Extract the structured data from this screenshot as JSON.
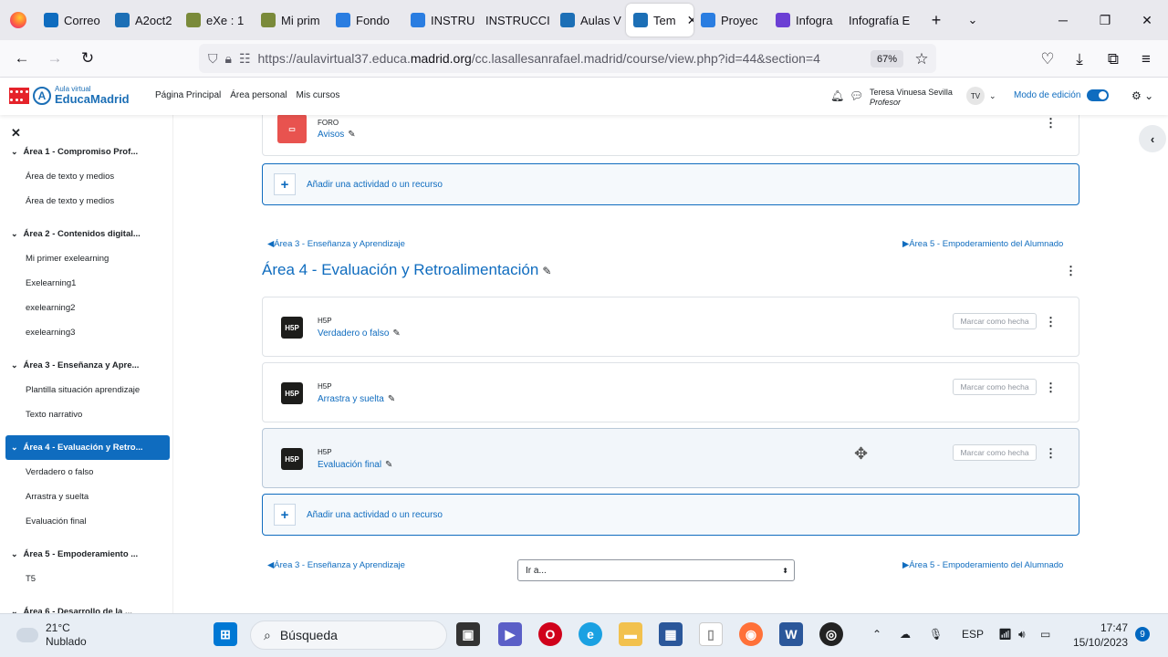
{
  "browser": {
    "tabs": [
      {
        "label": "Correo",
        "icon": "mail-icon",
        "color": "#0f6cbf"
      },
      {
        "label": "A2oct2",
        "icon": "moodle-cap-icon",
        "color": "#1c6fb6"
      },
      {
        "label": "eXe : 1",
        "icon": "exe-icon",
        "color": "#7a8a3a"
      },
      {
        "label": "Mi prim",
        "icon": "exe-icon",
        "color": "#7a8a3a"
      },
      {
        "label": "Fondo",
        "icon": "edge-c-icon",
        "color": "#2a7de1"
      },
      {
        "label": "INSTRU",
        "icon": "edge-c-icon",
        "color": "#2a7de1"
      },
      {
        "label": "INSTRUCCI",
        "icon": "",
        "color": "#888888"
      },
      {
        "label": "Aulas V",
        "icon": "aula-icon",
        "color": "#1c6fb6"
      },
      {
        "label": "Tem",
        "icon": "moodle-cap-icon",
        "color": "#1c6fb6",
        "active": true
      },
      {
        "label": "Proyec",
        "icon": "edge-c-icon",
        "color": "#2a7de1"
      },
      {
        "label": "Infogra",
        "icon": "doc-icon",
        "color": "#6b3fd4"
      },
      {
        "label": "Infografía E",
        "icon": "",
        "color": "#888888"
      }
    ],
    "url_prefix": "https://aulavirtual37.educa.",
    "url_host": "madrid.org",
    "url_suffix": "/cc.lasallesanrafael.madrid/course/view.php?id=44&section=4",
    "zoom": "67%"
  },
  "moodle": {
    "logo_top": "Aula virtual",
    "logo_bottom": "EducaMadrid",
    "nav": [
      "Página Principal",
      "Área personal",
      "Mis cursos"
    ],
    "user_name": "Teresa Vinuesa Sevilla",
    "user_role": "Profesor",
    "user_initials": "TV",
    "edit_mode_label": "Modo de edición"
  },
  "sidebar": {
    "sections": [
      {
        "title": "Área 1 - Compromiso Prof...",
        "items": [
          "Área de texto y medios",
          "Área de texto y medios"
        ]
      },
      {
        "title": "Área 2 - Contenidos digital...",
        "items": [
          "Mi primer exelearning",
          "Exelearning1",
          "exelearning2",
          "exelearning3"
        ]
      },
      {
        "title": "Área 3 - Enseñanza y Apre...",
        "items": [
          "Plantilla situación aprendizaje",
          "Texto narrativo"
        ]
      },
      {
        "title": "Área 4 - Evaluación y Retro...",
        "items": [
          "Verdadero o falso",
          "Arrastra y suelta",
          "Evaluación final"
        ],
        "active": true
      },
      {
        "title": "Área 5 - Empoderamiento ...",
        "items": [
          "T5"
        ]
      },
      {
        "title": "Área 6 - Desarrollo de la ...",
        "items": []
      }
    ]
  },
  "main": {
    "forum_type": "FORO",
    "forum_name": "Avisos",
    "add_label": "Añadir una actividad o un recurso",
    "prev_section": "◀Área 3 - Enseñanza y Aprendizaje",
    "next_section": "▶Área 5 - Empoderamiento del Alumnado",
    "section_title": "Área 4 - Evaluación y Retroalimentación",
    "activities": [
      {
        "type": "H5P",
        "name": "Verdadero o falso"
      },
      {
        "type": "H5P",
        "name": "Arrastra y suelta"
      },
      {
        "type": "H5P",
        "name": "Evaluación final"
      }
    ],
    "mark_done_label": "Marcar como hecha",
    "goto_label": "Ir a..."
  },
  "taskbar": {
    "temperature": "21°C",
    "weather": "Nublado",
    "search_placeholder": "Búsqueda",
    "lang": "ESP",
    "time": "17:47",
    "date": "15/10/2023",
    "notifications": "9"
  }
}
